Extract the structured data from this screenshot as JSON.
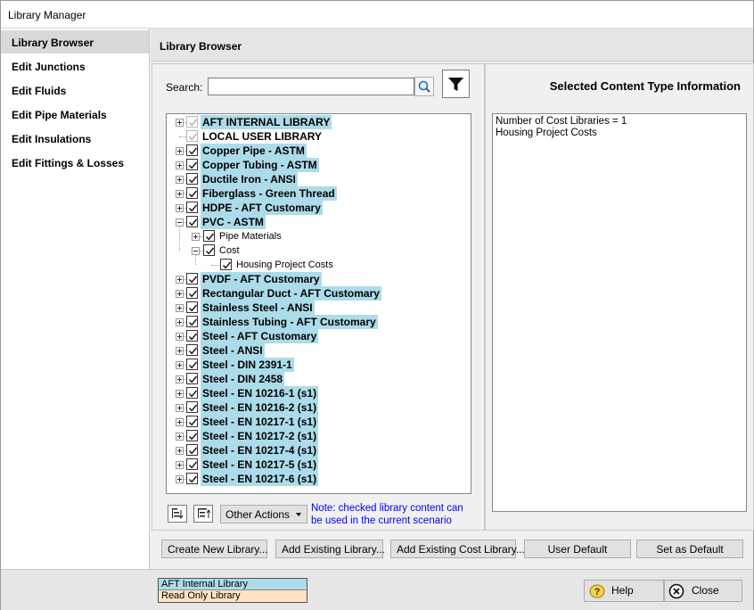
{
  "window": {
    "title": "Library Manager"
  },
  "sidebar": {
    "items": [
      {
        "label": "Library Browser",
        "active": true
      },
      {
        "label": "Edit Junctions"
      },
      {
        "label": "Edit Fluids"
      },
      {
        "label": "Edit Pipe Materials"
      },
      {
        "label": "Edit Insulations"
      },
      {
        "label": "Edit Fittings & Losses"
      }
    ]
  },
  "header": {
    "title": "Library Browser"
  },
  "search": {
    "label": "Search:",
    "value": ""
  },
  "tree": {
    "rows": [
      {
        "label": "AFT INTERNAL LIBRARY",
        "level": 0,
        "expand": "plus",
        "check": "gray",
        "style": "lib"
      },
      {
        "label": "LOCAL USER LIBRARY",
        "level": 0,
        "expand": "none",
        "check": "gray",
        "style": "lib-plain"
      },
      {
        "label": "Copper Pipe - ASTM",
        "level": 0,
        "expand": "plus",
        "check": "on",
        "style": "lib"
      },
      {
        "label": "Copper Tubing - ASTM",
        "level": 0,
        "expand": "plus",
        "check": "on",
        "style": "lib"
      },
      {
        "label": "Ductile Iron - ANSI",
        "level": 0,
        "expand": "plus",
        "check": "on",
        "style": "lib"
      },
      {
        "label": "Fiberglass - Green Thread",
        "level": 0,
        "expand": "plus",
        "check": "on",
        "style": "lib"
      },
      {
        "label": "HDPE - AFT Customary",
        "level": 0,
        "expand": "plus",
        "check": "on",
        "style": "lib"
      },
      {
        "label": "PVC - ASTM",
        "level": 0,
        "expand": "minus",
        "check": "on",
        "style": "lib"
      },
      {
        "label": "Pipe Materials",
        "level": 1,
        "expand": "plus",
        "check": "on",
        "style": "sub"
      },
      {
        "label": "Cost",
        "level": 1,
        "expand": "minus",
        "check": "on",
        "style": "sub"
      },
      {
        "label": "Housing Project Costs",
        "level": 2,
        "expand": "none",
        "check": "on",
        "style": "sub"
      },
      {
        "label": "PVDF - AFT Customary",
        "level": 0,
        "expand": "plus",
        "check": "on",
        "style": "lib"
      },
      {
        "label": "Rectangular Duct - AFT Customary",
        "level": 0,
        "expand": "plus",
        "check": "on",
        "style": "lib"
      },
      {
        "label": "Stainless Steel - ANSI",
        "level": 0,
        "expand": "plus",
        "check": "on",
        "style": "lib"
      },
      {
        "label": "Stainless Tubing - AFT Customary",
        "level": 0,
        "expand": "plus",
        "check": "on",
        "style": "lib"
      },
      {
        "label": "Steel - AFT Customary",
        "level": 0,
        "expand": "plus",
        "check": "on",
        "style": "lib"
      },
      {
        "label": "Steel - ANSI",
        "level": 0,
        "expand": "plus",
        "check": "on",
        "style": "lib"
      },
      {
        "label": "Steel - DIN 2391-1",
        "level": 0,
        "expand": "plus",
        "check": "on",
        "style": "lib"
      },
      {
        "label": "Steel - DIN 2458",
        "level": 0,
        "expand": "plus",
        "check": "on",
        "style": "lib"
      },
      {
        "label": "Steel - EN 10216-1 (s1)",
        "level": 0,
        "expand": "plus",
        "check": "on",
        "style": "lib"
      },
      {
        "label": "Steel - EN 10216-2 (s1)",
        "level": 0,
        "expand": "plus",
        "check": "on",
        "style": "lib"
      },
      {
        "label": "Steel - EN 10217-1 (s1)",
        "level": 0,
        "expand": "plus",
        "check": "on",
        "style": "lib"
      },
      {
        "label": "Steel - EN 10217-2 (s1)",
        "level": 0,
        "expand": "plus",
        "check": "on",
        "style": "lib"
      },
      {
        "label": "Steel - EN 10217-4 (s1)",
        "level": 0,
        "expand": "plus",
        "check": "on",
        "style": "lib"
      },
      {
        "label": "Steel - EN 10217-5 (s1)",
        "level": 0,
        "expand": "plus",
        "check": "on",
        "style": "lib"
      },
      {
        "label": "Steel - EN 10217-6 (s1)",
        "level": 0,
        "expand": "plus",
        "check": "on",
        "style": "lib"
      }
    ]
  },
  "tree_toolbar": {
    "other_actions": "Other Actions",
    "note_line1": "Note: checked library content can",
    "note_line2": "be used in the current scenario"
  },
  "info_panel": {
    "title": "Selected Content Type Information",
    "line1": "Number of Cost Libraries = 1",
    "line2": "Housing Project Costs"
  },
  "buttons": {
    "create_new_library": "Create New Library...",
    "add_existing_library": "Add Existing Library...",
    "add_existing_cost_library": "Add Existing Cost Library...",
    "user_default": "User Default",
    "set_as_default": "Set as Default"
  },
  "legend": {
    "internal": "AFT Internal Library",
    "read_only": "Read Only Library"
  },
  "footer": {
    "help": "Help",
    "close": "Close"
  },
  "colors": {
    "library_highlight": "#acdbe9",
    "read_only": "#ffe4c4",
    "note_text": "#0000ff"
  },
  "icons": [
    "search-icon",
    "filter-icon",
    "expand-all-icon",
    "collapse-all-icon",
    "help-icon",
    "close-icon"
  ]
}
